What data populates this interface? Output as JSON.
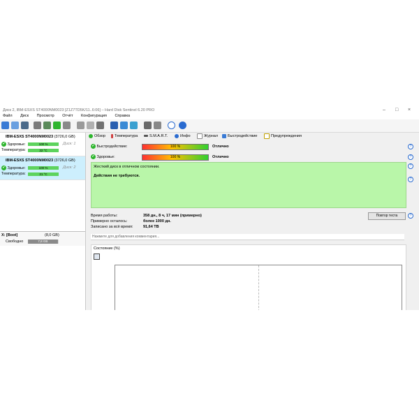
{
  "window": {
    "title": "Диск 2, IBM-ESXS ST4000NM0023 [Z1Z7TD5K/11..6:06]  –  Hard Disk Sentinel 6.20 PRO",
    "controls": [
      "–",
      "□",
      "×"
    ]
  },
  "menu": [
    "Файл",
    "Диск",
    "Просмотр",
    "Отчёт",
    "Конфигурация",
    "Справка"
  ],
  "disks": [
    {
      "name": "IBM-ESXS ST4000NM0023",
      "size": "(3726,0 GB)",
      "health_label": "Здоровье:",
      "health": "100 %",
      "health_fraction": 1.0,
      "disk_no": "Диск: 1",
      "temp_label": "Температура:",
      "temp": "22 °C",
      "selected": false
    },
    {
      "name": "IBM-ESXS ST4000NM0023",
      "size": "(3726,0 GB)",
      "health_label": "Здоровье:",
      "health": "100 %",
      "health_fraction": 1.0,
      "disk_no": "Диск: 2",
      "temp_label": "Температура:",
      "temp": "21 °C",
      "selected": true
    }
  ],
  "volume": {
    "name": "X: [Boot]",
    "size": "(8,0 GB)",
    "free_label": "Свободно",
    "free": "7,8 GB",
    "free_fraction": 0.97
  },
  "tabs": [
    {
      "label": "Обзор",
      "icon": "check-icon",
      "color": "#2db52d"
    },
    {
      "label": "Температура",
      "icon": "thermometer-icon",
      "color": "#d04040"
    },
    {
      "label": "S.M.A.R.T.",
      "icon": "disk-icon",
      "color": "#555555"
    },
    {
      "label": "Инфо",
      "icon": "info-icon",
      "color": "#2a6bd0"
    },
    {
      "label": "Журнал",
      "icon": "document-icon",
      "color": "#888888"
    },
    {
      "label": "Быстродействие",
      "icon": "performance-icon",
      "color": "#3a7bd5"
    },
    {
      "label": "Предупреждения",
      "icon": "alert-icon",
      "color": "#c0a000"
    }
  ],
  "status": {
    "perf_label": "Быстродействие:",
    "perf_value": "100 %",
    "perf_text": "Отлично",
    "health_label": "Здоровье:",
    "health_value": "100 %",
    "health_text": "Отлично"
  },
  "message": {
    "line1": "Жесткий диск в отличном состоянии.",
    "line2": "Действия не требуются."
  },
  "info": {
    "uptime_label": "Время работы:",
    "uptime_value": "358 дн., 8 ч, 17 мин (примерно)",
    "remaining_label": "Примерно осталось:",
    "remaining_value": "более 1000 дн.",
    "written_label": "Записано за всё время:",
    "written_value": "91,64 TB"
  },
  "test_button": "Повтор теста",
  "comment_placeholder": "Нажмите для добавления комментария...",
  "chart_section": {
    "label": "Состояние (%)"
  },
  "colors": {
    "selected": "#cdeffd",
    "message_bg": "#b9f6a9",
    "health_green": "#5dd35d"
  }
}
